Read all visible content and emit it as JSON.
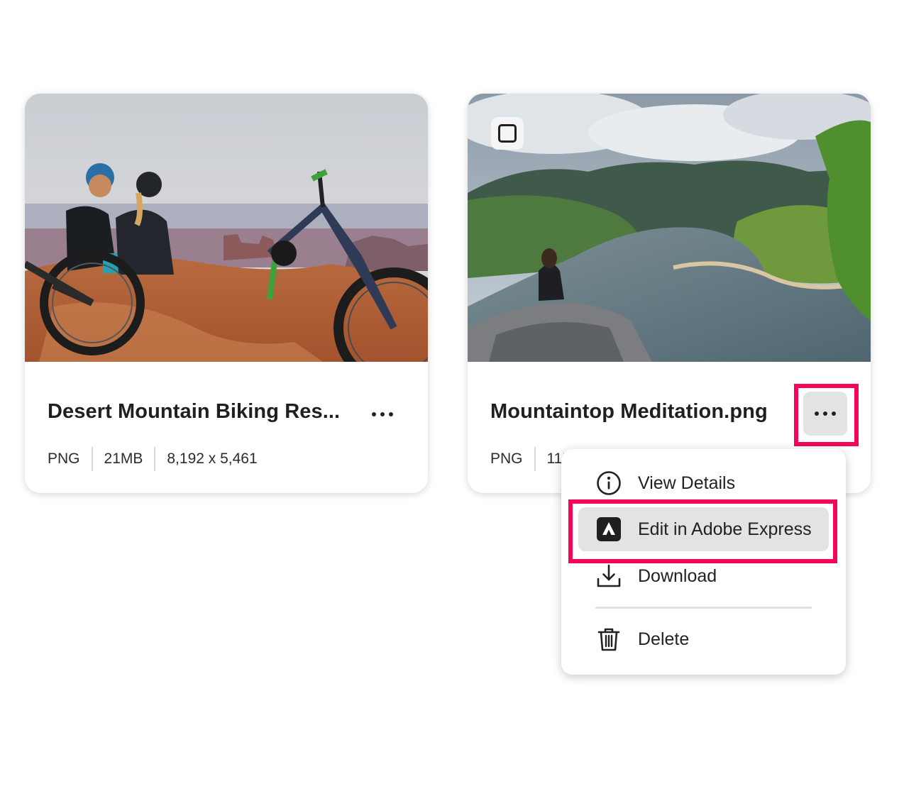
{
  "cards": [
    {
      "title": "Desert Mountain Biking Res...",
      "format": "PNG",
      "size": "21MB",
      "dimensions": "8,192 x 5,461"
    },
    {
      "title": "Mountaintop Meditation.png",
      "format": "PNG",
      "size": "11M"
    }
  ],
  "menu": {
    "items": [
      {
        "label": "View Details",
        "icon": "info-icon"
      },
      {
        "label": "Edit in Adobe Express",
        "icon": "adobe-express-icon"
      },
      {
        "label": "Download",
        "icon": "download-icon"
      },
      {
        "label": "Delete",
        "icon": "trash-icon"
      }
    ]
  },
  "colors": {
    "highlight": "#f5055a",
    "hover_background": "#e3e3e3"
  }
}
